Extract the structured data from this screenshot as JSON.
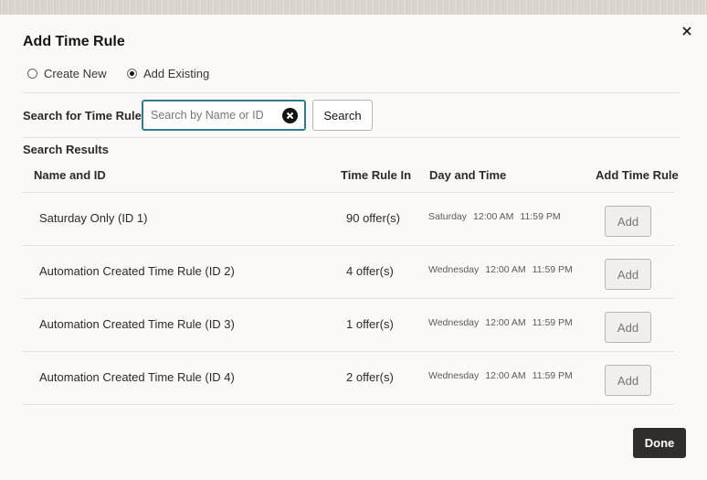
{
  "dialog": {
    "title": "Add Time Rule",
    "close_icon": "close-icon"
  },
  "mode": {
    "options": [
      {
        "label": "Create New",
        "selected": false
      },
      {
        "label": "Add Existing",
        "selected": true
      }
    ]
  },
  "search": {
    "label": "Search for Time Rule",
    "placeholder": "Search by Name or ID",
    "value": "",
    "button_label": "Search",
    "clear_icon": "clear-icon"
  },
  "results": {
    "label": "Search Results",
    "columns": [
      "Name and ID",
      "Time Rule In",
      "Day and Time",
      "Add Time Rule"
    ],
    "rows": [
      {
        "name": "Saturday Only (ID 1)",
        "offers": "90 offer(s)",
        "day": "Saturday",
        "start": "12:00 AM",
        "end": "11:59 PM",
        "action": "Add"
      },
      {
        "name": "Automation Created Time Rule (ID 2)",
        "offers": "4 offer(s)",
        "day": "Wednesday",
        "start": "12:00 AM",
        "end": "11:59 PM",
        "action": "Add"
      },
      {
        "name": "Automation Created Time Rule (ID 3)",
        "offers": "1 offer(s)",
        "day": "Wednesday",
        "start": "12:00 AM",
        "end": "11:59 PM",
        "action": "Add"
      },
      {
        "name": "Automation Created Time Rule (ID 4)",
        "offers": "2 offer(s)",
        "day": "Wednesday",
        "start": "12:00 AM",
        "end": "11:59 PM",
        "action": "Add"
      }
    ]
  },
  "footer": {
    "done_label": "Done"
  },
  "colors": {
    "primary_button": "#312d2a",
    "focus_border": "#2f7d8c",
    "background": "#fbf9f8"
  }
}
